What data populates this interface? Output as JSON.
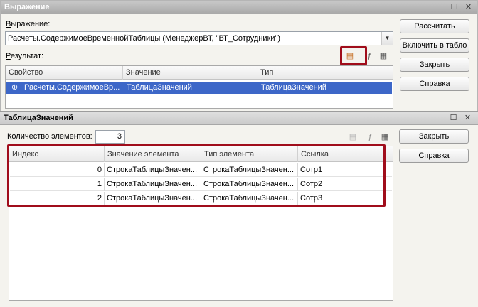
{
  "expr_window": {
    "title": "Выражение",
    "expression_label_prefix": "В",
    "expression_label_rest": "ыражение:",
    "expression_value": "Расчеты.СодержимоеВременнойТаблицы (МенеджерВТ, \"ВТ_Сотрудники\")",
    "result_label_prefix": "Р",
    "result_label_rest": "езультат:",
    "buttons": {
      "calculate": "Рассчитать",
      "to_table": "Включить в табло",
      "close": "Закрыть",
      "help": "Справка"
    },
    "result_columns": [
      "Свойство",
      "Значение",
      "Тип"
    ],
    "result_row": {
      "toggle": "⊕",
      "property": "Расчеты.СодержимоеВр...",
      "value": "ТаблицаЗначений",
      "type": "ТаблицаЗначений"
    }
  },
  "table_window": {
    "title": "ТаблицаЗначений",
    "count_label": "Количество элементов:",
    "count_value": "3",
    "buttons": {
      "close": "Закрыть",
      "help": "Справка"
    },
    "columns": [
      "Индекс",
      "Значение элемента",
      "Тип элемента",
      "Ссылка"
    ],
    "rows": [
      {
        "index": "0",
        "value": "СтрокаТаблицыЗначен...",
        "type": "СтрокаТаблицыЗначен...",
        "ref": "Сотр1"
      },
      {
        "index": "1",
        "value": "СтрокаТаблицыЗначен...",
        "type": "СтрокаТаблицыЗначен...",
        "ref": "Сотр2"
      },
      {
        "index": "2",
        "value": "СтрокаТаблицыЗначен...",
        "type": "СтрокаТаблицыЗначен...",
        "ref": "Сотр3"
      }
    ]
  },
  "colors": {
    "selection": "#3d67c8",
    "highlight": "#a00d1b",
    "window_bg": "#f4f3ee"
  },
  "icons": [
    "chevron-down-icon",
    "open-table-icon",
    "fx-icon",
    "print-icon",
    "maximize-icon",
    "close-icon"
  ]
}
